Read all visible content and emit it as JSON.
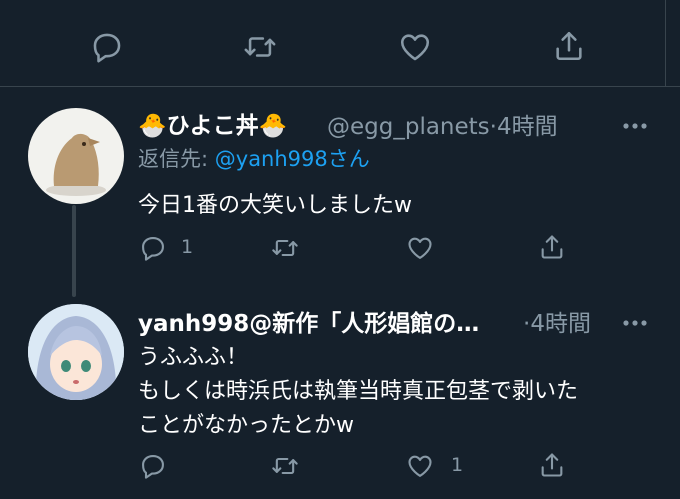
{
  "top_actions": {
    "reply_icon": "reply-icon",
    "retweet_icon": "retweet-icon",
    "like_icon": "heart-icon",
    "share_icon": "share-icon"
  },
  "tweets": [
    {
      "display_name": "ひよこ丼",
      "name_emoji": "🐣",
      "handle": "@egg_planets",
      "separator": "·",
      "time": "4時間",
      "reply_prefix": "返信先: ",
      "reply_to": "@yanh998さん",
      "text": "今日1番の大笑いしましたw",
      "reply_count": "1",
      "like_count": ""
    },
    {
      "display_name": "yanh998@新作「人形娼館の…",
      "handle": "",
      "separator": "·",
      "time": "4時間",
      "text_lines": [
        "うふふふ！",
        "もしくは時浜氏は執筆当時真正包茎で剥いた",
        "ことがなかったとかw"
      ],
      "reply_count": "",
      "like_count": "1"
    }
  ],
  "colors": {
    "background": "#15202b",
    "divider": "#38444d",
    "secondary_text": "#8899a6",
    "link": "#1da1f2"
  }
}
